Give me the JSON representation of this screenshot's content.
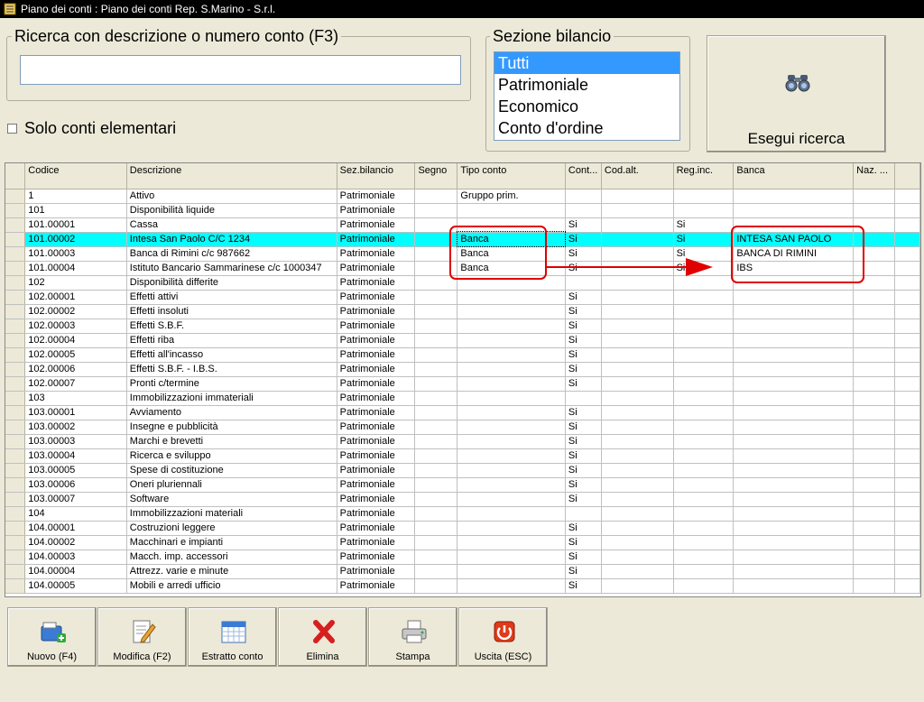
{
  "window": {
    "title": "Piano dei conti : Piano dei conti Rep. S.Marino - S.r.l."
  },
  "search": {
    "label": "Ricerca con descrizione o numero conto (F3)",
    "value": ""
  },
  "filter": {
    "solo_label": "Solo conti elementari",
    "solo_checked": false
  },
  "section": {
    "label": "Sezione bilancio",
    "options": [
      "Tutti",
      "Patrimoniale",
      "Economico",
      "Conto d'ordine"
    ],
    "selected": 0
  },
  "execute": {
    "label": "Esegui ricerca",
    "icon": "binoculars-icon"
  },
  "grid": {
    "columns": [
      "Codice",
      "Descrizione",
      "Sez.bilancio",
      "Segno",
      "Tipo conto",
      "Cont...",
      "Cod.alt.",
      "Reg.inc.",
      "Banca",
      "Naz. ..."
    ],
    "selected_row": 3,
    "rows": [
      [
        "1",
        "Attivo",
        "Patrimoniale",
        "",
        "Gruppo prim.",
        "",
        "",
        "",
        "",
        ""
      ],
      [
        "101",
        "Disponibilità liquide",
        "Patrimoniale",
        "",
        "",
        "",
        "",
        "",
        "",
        ""
      ],
      [
        "101.00001",
        "Cassa",
        "Patrimoniale",
        "",
        "",
        "Si",
        "",
        "Si",
        "",
        ""
      ],
      [
        "101.00002",
        "Intesa San Paolo C/C 1234",
        "Patrimoniale",
        "",
        "Banca",
        "Si",
        "",
        "Si",
        "INTESA SAN PAOLO",
        ""
      ],
      [
        "101.00003",
        "Banca di Rimini c/c 987662",
        "Patrimoniale",
        "",
        "Banca",
        "Si",
        "",
        "Si",
        "BANCA DI RIMINI",
        ""
      ],
      [
        "101.00004",
        "Istituto Bancario Sammarinese c/c 1000347",
        "Patrimoniale",
        "",
        "Banca",
        "Si",
        "",
        "Si",
        "IBS",
        ""
      ],
      [
        "102",
        "Disponibilità differite",
        "Patrimoniale",
        "",
        "",
        "",
        "",
        "",
        "",
        ""
      ],
      [
        "102.00001",
        "Effetti attivi",
        "Patrimoniale",
        "",
        "",
        "Si",
        "",
        "",
        "",
        ""
      ],
      [
        "102.00002",
        "Effetti insoluti",
        "Patrimoniale",
        "",
        "",
        "Si",
        "",
        "",
        "",
        ""
      ],
      [
        "102.00003",
        "Effetti S.B.F.",
        "Patrimoniale",
        "",
        "",
        "Si",
        "",
        "",
        "",
        ""
      ],
      [
        "102.00004",
        "Effetti riba",
        "Patrimoniale",
        "",
        "",
        "Si",
        "",
        "",
        "",
        ""
      ],
      [
        "102.00005",
        "Effetti all'incasso",
        "Patrimoniale",
        "",
        "",
        "Si",
        "",
        "",
        "",
        ""
      ],
      [
        "102.00006",
        "Effetti S.B.F. - I.B.S.",
        "Patrimoniale",
        "",
        "",
        "Si",
        "",
        "",
        "",
        ""
      ],
      [
        "102.00007",
        "Pronti c/termine",
        "Patrimoniale",
        "",
        "",
        "Si",
        "",
        "",
        "",
        ""
      ],
      [
        "103",
        "Immobilizzazioni immateriali",
        "Patrimoniale",
        "",
        "",
        "",
        "",
        "",
        "",
        ""
      ],
      [
        "103.00001",
        "Avviamento",
        "Patrimoniale",
        "",
        "",
        "Si",
        "",
        "",
        "",
        ""
      ],
      [
        "103.00002",
        "Insegne e pubblicità",
        "Patrimoniale",
        "",
        "",
        "Si",
        "",
        "",
        "",
        ""
      ],
      [
        "103.00003",
        "Marchi e brevetti",
        "Patrimoniale",
        "",
        "",
        "Si",
        "",
        "",
        "",
        ""
      ],
      [
        "103.00004",
        "Ricerca e sviluppo",
        "Patrimoniale",
        "",
        "",
        "Si",
        "",
        "",
        "",
        ""
      ],
      [
        "103.00005",
        "Spese di costituzione",
        "Patrimoniale",
        "",
        "",
        "Si",
        "",
        "",
        "",
        ""
      ],
      [
        "103.00006",
        "Oneri pluriennali",
        "Patrimoniale",
        "",
        "",
        "Si",
        "",
        "",
        "",
        ""
      ],
      [
        "103.00007",
        "Software",
        "Patrimoniale",
        "",
        "",
        "Si",
        "",
        "",
        "",
        ""
      ],
      [
        "104",
        "Immobilizzazioni materiali",
        "Patrimoniale",
        "",
        "",
        "",
        "",
        "",
        "",
        ""
      ],
      [
        "104.00001",
        "Costruzioni leggere",
        "Patrimoniale",
        "",
        "",
        "Si",
        "",
        "",
        "",
        ""
      ],
      [
        "104.00002",
        "Macchinari e impianti",
        "Patrimoniale",
        "",
        "",
        "Si",
        "",
        "",
        "",
        ""
      ],
      [
        "104.00003",
        "Macch. imp. accessori",
        "Patrimoniale",
        "",
        "",
        "Si",
        "",
        "",
        "",
        ""
      ],
      [
        "104.00004",
        "Attrezz. varie e minute",
        "Patrimoniale",
        "",
        "",
        "Si",
        "",
        "",
        "",
        ""
      ],
      [
        "104.00005",
        "Mobili e arredi ufficio",
        "Patrimoniale",
        "",
        "",
        "Si",
        "",
        "",
        "",
        ""
      ]
    ]
  },
  "toolbar": {
    "buttons": [
      {
        "label": "Nuovo (F4)",
        "icon": "new-folder-icon"
      },
      {
        "label": "Modifica (F2)",
        "icon": "edit-pencil-icon"
      },
      {
        "label": "Estratto conto",
        "icon": "calendar-icon"
      },
      {
        "label": "Elimina",
        "icon": "delete-x-icon"
      },
      {
        "label": "Stampa",
        "icon": "printer-icon"
      },
      {
        "label": "Uscita (ESC)",
        "icon": "power-exit-icon"
      }
    ]
  },
  "colors": {
    "selected_row": "#00ffff",
    "list_selection": "#3399ff",
    "annotation": "#e00000"
  }
}
